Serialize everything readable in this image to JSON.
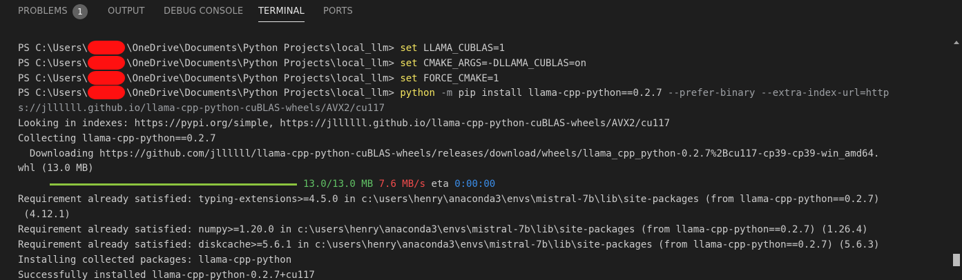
{
  "tabs": [
    {
      "label": "PROBLEMS",
      "badge": "1"
    },
    {
      "label": "OUTPUT"
    },
    {
      "label": "DEBUG CONSOLE"
    },
    {
      "label": "TERMINAL",
      "active": true
    },
    {
      "label": "PORTS"
    }
  ],
  "prompt": {
    "prefix": "PS C:\\Users\\",
    "suffix": "\\OneDrive\\Documents\\Python Projects\\local_llm> "
  },
  "commands": [
    {
      "cmd": "set",
      "args": " LLAMA_CUBLAS=1"
    },
    {
      "cmd": "set",
      "args": " CMAKE_ARGS=-DLLAMA_CUBLAS=on"
    },
    {
      "cmd": "set",
      "args": " FORCE_CMAKE=1"
    },
    {
      "cmd": "python",
      "opt1": " -m",
      "mid": " pip install llama-cpp-python==0.2.7",
      "opt2": " --prefer-binary --extra-index-url=http",
      "wrap": "s://jllllll.github.io/llama-cpp-python-cuBLAS-wheels/AVX2/cu117"
    }
  ],
  "output": {
    "indexes": "Looking in indexes: https://pypi.org/simple, https://jllllll.github.io/llama-cpp-python-cuBLAS-wheels/AVX2/cu117",
    "collecting": "Collecting llama-cpp-python==0.2.7",
    "downloading": "  Downloading https://github.com/jllllll/llama-cpp-python-cuBLAS-wheels/releases/download/wheels/llama_cpp_python-0.2.7%2Bcu117-cp39-cp39-win_amd64.",
    "downloading_wrap": "whl (13.0 MB)",
    "progress": {
      "fraction": 1.0,
      "size": "13.0/13.0 MB",
      "speed": "7.6 MB/s",
      "eta_label": "eta",
      "eta": "0:00:00",
      "bar_color": "#8cc43f"
    },
    "req1": "Requirement already satisfied: typing-extensions>=4.5.0 in c:\\users\\henry\\anaconda3\\envs\\mistral-7b\\lib\\site-packages (from llama-cpp-python==0.2.7)",
    "req1_wrap": " (4.12.1)",
    "req2": "Requirement already satisfied: numpy>=1.20.0 in c:\\users\\henry\\anaconda3\\envs\\mistral-7b\\lib\\site-packages (from llama-cpp-python==0.2.7) (1.26.4)",
    "req3": "Requirement already satisfied: diskcache>=5.6.1 in c:\\users\\henry\\anaconda3\\envs\\mistral-7b\\lib\\site-packages (from llama-cpp-python==0.2.7) (5.6.3)",
    "installing": "Installing collected packages: llama-cpp-python",
    "success": "Successfully installed llama-cpp-python-0.2.7+cu117"
  },
  "colors": {
    "background": "#1e1e1e",
    "command": "#f2e35f",
    "parameter": "#9da0a4",
    "text": "#cccccc",
    "size": "#61c265",
    "speed": "#f14c4c",
    "eta": "#3b8eea",
    "redaction": "#ff1010"
  }
}
